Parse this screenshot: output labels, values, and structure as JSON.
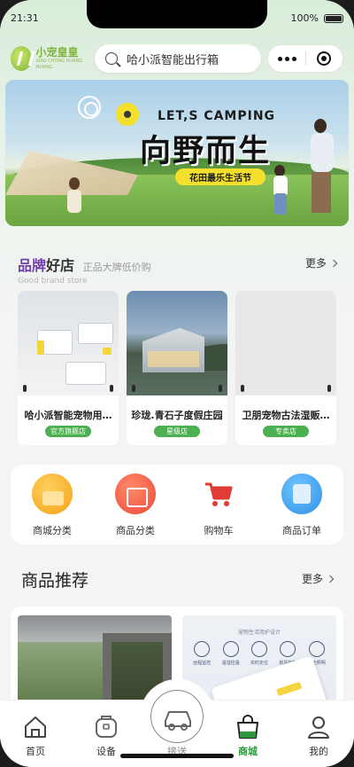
{
  "status_bar": {
    "time": "21:31",
    "battery": "100%"
  },
  "header": {
    "logo_cn": "小宠皇皇",
    "logo_sub": "XIAO CHONG HUANG HUANG",
    "search_value": "哈小派智能出行箱"
  },
  "banner": {
    "en_text": "LET,S CAMPING",
    "title": "向野而生",
    "tag": "花田最乐生活节"
  },
  "brand_stores": {
    "title_highlight": "品牌",
    "title_rest": "好店",
    "subtitle": "正品大牌低价购",
    "en_subtitle": "Good brand store",
    "more_label": "更多",
    "items": [
      {
        "name": "哈小派智能宠物用…",
        "badge": "官方旗舰店"
      },
      {
        "name": "珍珑.青石子度假庄园",
        "badge": "星级店"
      },
      {
        "name": "卫朋宠物古法湿贩…",
        "badge": "专卖店"
      }
    ]
  },
  "categories": [
    {
      "label": "商城分类",
      "icon": "shop-category-icon"
    },
    {
      "label": "商品分类",
      "icon": "product-category-icon"
    },
    {
      "label": "购物车",
      "icon": "shopping-cart-icon"
    },
    {
      "label": "商品订单",
      "icon": "order-list-icon"
    }
  ],
  "recommend": {
    "title": "商品推荐",
    "more_label": "更多",
    "card2_title": "宠物生活用护设计",
    "card2_features": [
      "远程监控",
      "温湿控温",
      "实时定位",
      "新风控制",
      "柔光照明"
    ]
  },
  "tabbar": [
    {
      "label": "首页",
      "icon": "home-icon",
      "active": false
    },
    {
      "label": "设备",
      "icon": "device-icon",
      "active": false
    },
    {
      "label": "接送",
      "icon": "car-icon",
      "active": false
    },
    {
      "label": "商城",
      "icon": "shopping-bag-icon",
      "active": true
    },
    {
      "label": "我的",
      "icon": "profile-icon",
      "active": false
    }
  ],
  "colors": {
    "accent": "#2c9a3c",
    "badge": "#4cb050",
    "brand_purple": "#6f3fae"
  }
}
